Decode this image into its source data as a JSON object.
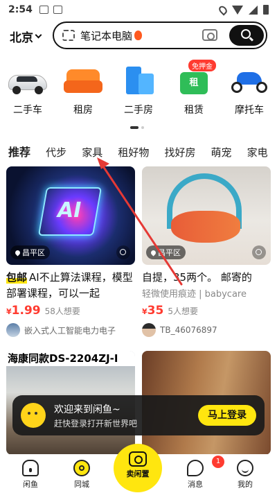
{
  "status_bar": {
    "time": "2:54"
  },
  "header": {
    "city": "北京",
    "search_text": "笔记本电脑"
  },
  "categories": [
    {
      "label": "二手车",
      "icon": "car-icon"
    },
    {
      "label": "租房",
      "icon": "sofa-icon"
    },
    {
      "label": "二手房",
      "icon": "building-icon"
    },
    {
      "label": "租赁",
      "icon": "rent-box-icon",
      "badge": "免押金"
    },
    {
      "label": "摩托车",
      "icon": "motorcycle-icon"
    }
  ],
  "tabs": [
    "推荐",
    "代步",
    "家具",
    "租好物",
    "找好房",
    "萌宠",
    "家电",
    "乐"
  ],
  "feed": [
    {
      "location": "昌平区",
      "tag": "包邮",
      "title": "AI不止算法课程，模型部署课程，可以一起",
      "price_symbol": "¥",
      "price": "1.99",
      "wants": "58人想要",
      "seller": "嵌入式人工智能电力电子"
    },
    {
      "location": "昌平区",
      "title": "自提，35两个。 邮寄的",
      "subtitle": "轻微使用痕迹 | babycare",
      "price_symbol": "¥",
      "price": "35",
      "wants": "5人想要",
      "seller": "TB_46076897"
    },
    {
      "banner": "海康同款DS-2204ZJ-I"
    },
    {
      "banner": ""
    }
  ],
  "login_prompt": {
    "title": "欢迎来到闲鱼~",
    "subtitle": "赶快登录打开新世界吧",
    "button": "马上登录"
  },
  "bottom_nav": {
    "home": "闲鱼",
    "city": "同城",
    "sell": "卖闲置",
    "messages": "消息",
    "messages_badge": "1",
    "me": "我的"
  },
  "colors": {
    "accent": "#ffe60f",
    "price": "#ff3b30",
    "annotation_arrow": "#e53935"
  }
}
